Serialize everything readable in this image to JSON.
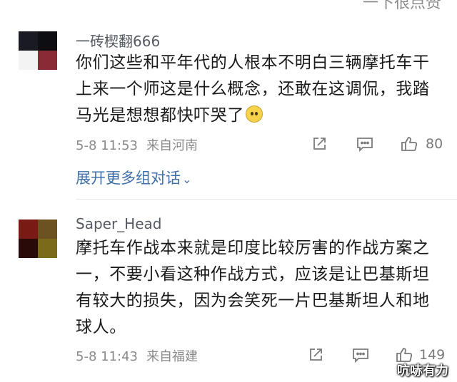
{
  "top_cut_text": "一下很点赞",
  "comments": [
    {
      "username": "一砖楔翻666",
      "lines": [
        "你们这些和平年代的人根本不明白三辆摩托车干",
        "上来一个师这是什么概念，还敢在这调侃，我踏",
        "马光是想想都快吓哭了"
      ],
      "emoji": "crying-face-emoji",
      "date_time": "5-8 11:53",
      "location": "来自河南",
      "likes": "80",
      "avatar_colors": [
        "#1a1a22",
        "#0d0d12",
        "#f3f3f3",
        "#8a2a35"
      ]
    },
    {
      "username": "Saper_Head",
      "lines": [
        "摩托车作战本来就是印度比较厉害的作战方案之",
        "一，不要小看这种作战方式，应该是让巴基斯坦",
        "有较大的损失，因为会笑死一片巴基斯坦人和地",
        "球人。"
      ],
      "date_time": "5-8 11:43",
      "location": "来自福建",
      "likes": "149",
      "avatar_colors": [
        "#7a1a14",
        "#6b5220",
        "#2a0a08",
        "#7a6a1a"
      ]
    }
  ],
  "expand_label": "展开更多组对话",
  "watermark": "吭哧有力",
  "colors": {
    "link": "#3f6fa8",
    "meta": "#8a8a8a",
    "divider": "#e6e6e6"
  }
}
